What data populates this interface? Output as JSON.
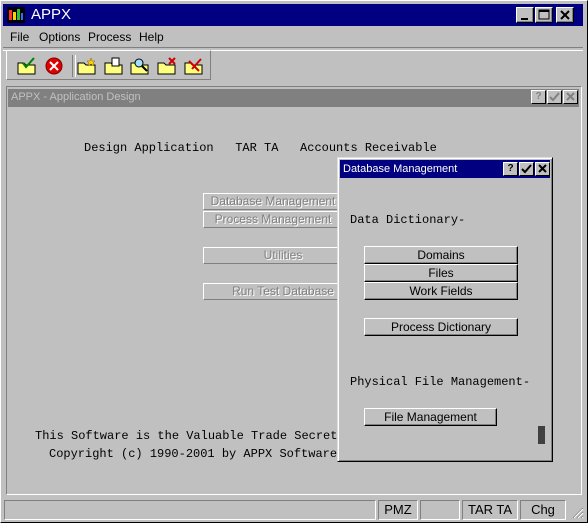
{
  "window": {
    "title": "APPX",
    "caption_buttons": [
      "minimize-icon",
      "maximize-icon",
      "close-icon"
    ]
  },
  "menubar": {
    "items": [
      "File",
      "Options",
      "Process",
      "Help"
    ]
  },
  "toolbar": {
    "icons": [
      "check-folder-icon",
      "cancel-icon",
      "new-folder-icon",
      "open-folder-icon",
      "search-folder-icon",
      "delete-folder-icon",
      "edit-folder-icon"
    ]
  },
  "child_window": {
    "title": "APPX - Application Design",
    "header_line": "Design Application   TAR TA   Accounts Receivable",
    "buttons": [
      "Database Management",
      "Process Management",
      "Utilities",
      "Run Test Database"
    ],
    "footer_line1": "This Software is the Valuable Trade Secret",
    "footer_line2": "Copyright (c) 1990-2001 by APPX Software,"
  },
  "dialog": {
    "title": "Database Management",
    "section1": "Data Dictionary-",
    "buttons1": [
      "Domains",
      "Files",
      "Work Fields"
    ],
    "button_process": "Process Dictionary",
    "section2": "Physical File Management-",
    "button_file": "File Management"
  },
  "statusbar": {
    "cells": [
      "",
      "PMZ",
      "",
      "TAR TA",
      "Chg"
    ]
  },
  "colors": {
    "active_title": "#000080",
    "inactive_title": "#808080",
    "face": "#c0c0c0"
  }
}
